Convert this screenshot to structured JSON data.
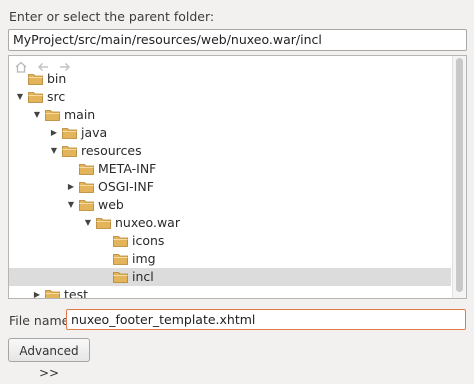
{
  "prompt": "Enter or select the parent folder:",
  "parent_path": "MyProject/src/main/resources/web/nuxeo.war/incl",
  "colors": {
    "folder": "#e4b45a",
    "selection": "#dcdcdc",
    "focus_border": "#e07c4a"
  },
  "toolbar": [
    {
      "icon": "home-icon"
    },
    {
      "icon": "back-arrow-icon"
    },
    {
      "icon": "forward-arrow-icon"
    }
  ],
  "tree": [
    {
      "label": "bin",
      "depth": 0,
      "expander": "none",
      "selected": false
    },
    {
      "label": "src",
      "depth": 0,
      "expander": "expanded",
      "selected": false
    },
    {
      "label": "main",
      "depth": 1,
      "expander": "expanded",
      "selected": false
    },
    {
      "label": "java",
      "depth": 2,
      "expander": "collapsed",
      "selected": false
    },
    {
      "label": "resources",
      "depth": 2,
      "expander": "expanded",
      "selected": false
    },
    {
      "label": "META-INF",
      "depth": 3,
      "expander": "none",
      "selected": false
    },
    {
      "label": "OSGI-INF",
      "depth": 3,
      "expander": "collapsed",
      "selected": false
    },
    {
      "label": "web",
      "depth": 3,
      "expander": "expanded",
      "selected": false
    },
    {
      "label": "nuxeo.war",
      "depth": 4,
      "expander": "expanded",
      "selected": false
    },
    {
      "label": "icons",
      "depth": 5,
      "expander": "none",
      "selected": false
    },
    {
      "label": "img",
      "depth": 5,
      "expander": "none",
      "selected": false
    },
    {
      "label": "incl",
      "depth": 5,
      "expander": "none",
      "selected": true
    },
    {
      "label": "test",
      "depth": 1,
      "expander": "collapsed",
      "selected": false
    }
  ],
  "file_name_label": "File name:",
  "file_name_value": "nuxeo_footer_template.xhtml",
  "advanced_button": "Advanced >>"
}
